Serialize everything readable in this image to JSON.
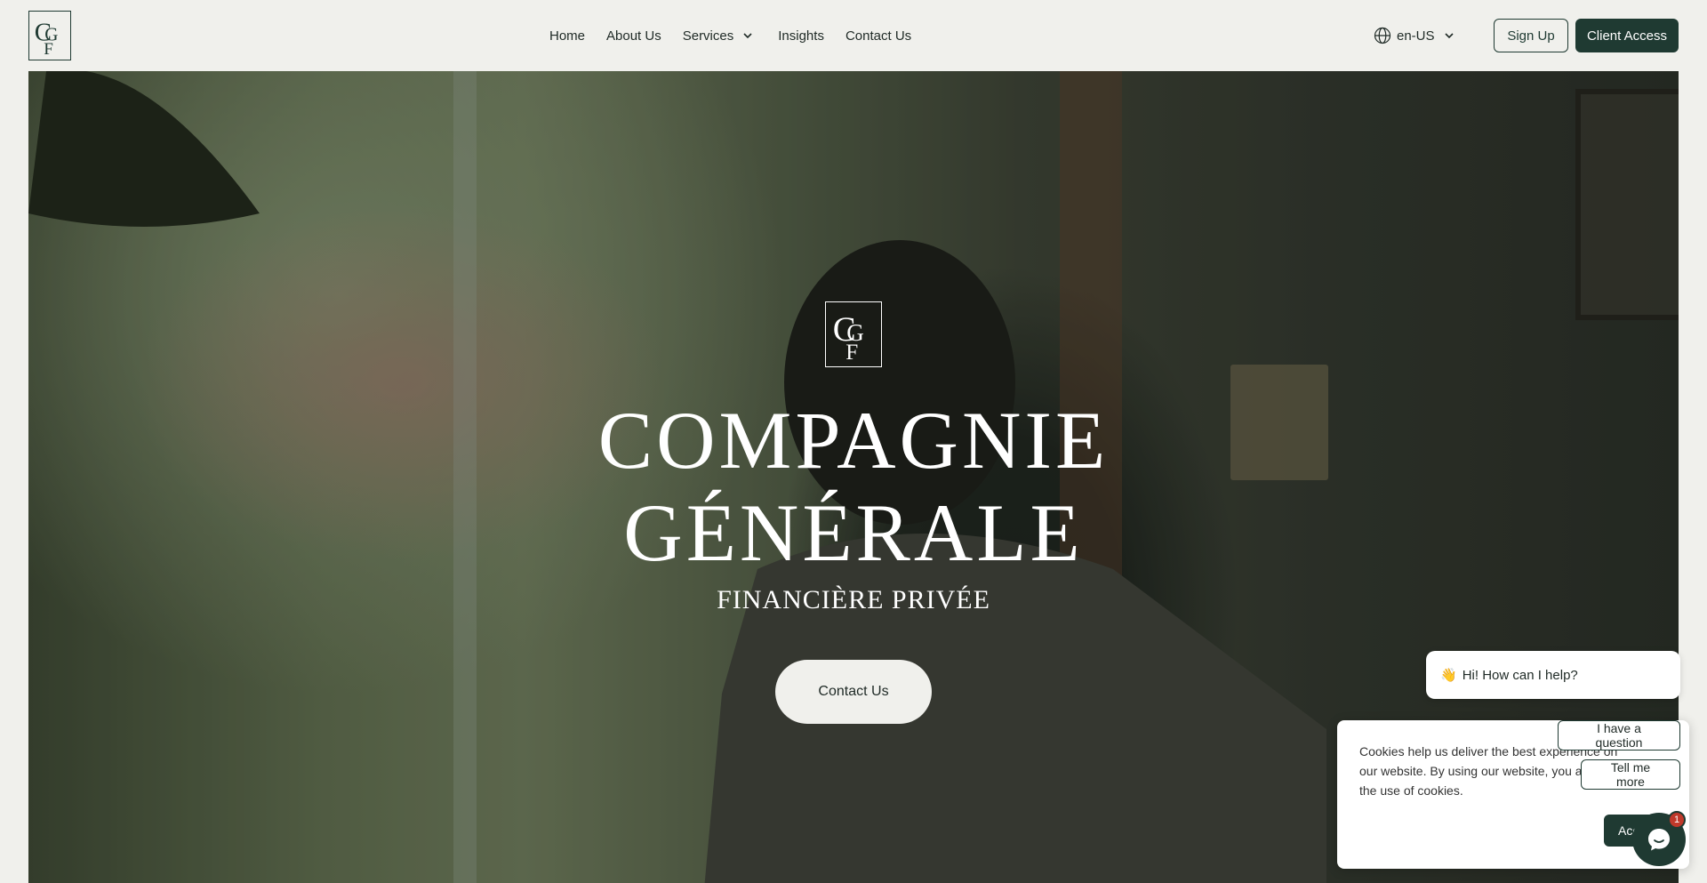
{
  "header": {
    "logo_alt": "CGF",
    "nav": [
      {
        "label": "Home"
      },
      {
        "label": "About Us"
      },
      {
        "label": "Services"
      },
      {
        "label": "Insights"
      },
      {
        "label": "Contact Us"
      }
    ],
    "language": "en-US",
    "sign_up_label": "Sign Up",
    "client_access_label": "Client Access"
  },
  "hero": {
    "title_line1": "COMPAGNIE",
    "title_line2": "GÉNÉRALE",
    "subtitle": "FINANCIÈRE PRIVÉE",
    "cta_label": "Contact Us"
  },
  "chat": {
    "greeting_emoji": "👋",
    "greeting": "Hi! How can I help?",
    "quick_replies": [
      "I have a question",
      "Tell me more"
    ],
    "unread_count": "1"
  },
  "cookie_banner": {
    "text": "Cookies help us deliver the best experience on our website. By using our website, you agree to the use of cookies.",
    "accept_label": "Accept"
  },
  "colors": {
    "brand": "#1f3a32",
    "background": "#f0f0ec"
  }
}
